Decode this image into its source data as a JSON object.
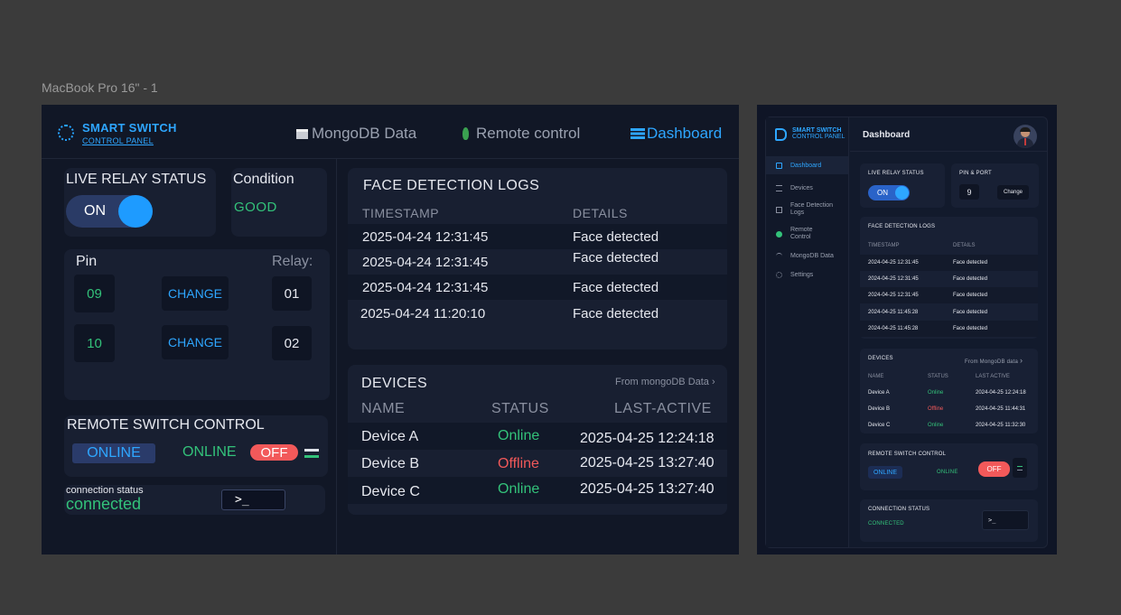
{
  "frame_label": "MacBook Pro 16\" - 1",
  "desktop": {
    "logo": {
      "title": "SMART SWITCH",
      "subtitle": "CONTROL PANEL"
    },
    "nav": [
      {
        "label": "MongoDB Data",
        "icon": "database-icon"
      },
      {
        "label": "Remote control",
        "icon": "mongodb-leaf-icon"
      },
      {
        "label": "Dashboard",
        "icon": "menu-icon",
        "active": true
      }
    ],
    "live_relay": {
      "title": "LIVE RELAY STATUS",
      "toggle_label": "ON"
    },
    "condition": {
      "title": "Condition",
      "value": "GOOD"
    },
    "pins": {
      "pin_label": "Pin",
      "relay_label": "Relay:",
      "rows": [
        {
          "pin": "09",
          "action": "CHANGE",
          "relay": "01"
        },
        {
          "pin": "10",
          "action": "CHANGE",
          "relay": "02"
        }
      ]
    },
    "remote": {
      "title": "REMOTE SWITCH CONTROL",
      "pill": "ONLINE",
      "status": "ONLINE",
      "switch": "OFF"
    },
    "connection": {
      "label": "connection status",
      "value": "connected",
      "terminal": ">_"
    },
    "face_logs": {
      "title": "FACE DETECTION LOGS",
      "headers": [
        "TIMESTAMP",
        "DETAILS"
      ],
      "rows": [
        [
          "2025-04-24 12:31:45",
          "Face detected"
        ],
        [
          "2025-04-24 12:31:45",
          "Face detected"
        ],
        [
          "2025-04-24 12:31:45",
          "Face detected"
        ],
        [
          "2025-04-24 11:20:10",
          "Face detected"
        ]
      ]
    },
    "devices": {
      "title": "DEVICES",
      "link": "From mongoDB Data",
      "headers": [
        "NAME",
        "STATUS",
        "LAST-ACTIVE"
      ],
      "rows": [
        [
          "Device A",
          "Online",
          "2025-04-25 12:24:18"
        ],
        [
          "Device B",
          "Offline",
          "2025-04-25 13:27:40"
        ],
        [
          "Device C",
          "Online",
          "2025-04-25 13:27:40"
        ]
      ]
    }
  },
  "mobile": {
    "logo": {
      "title": "SMART SWITCH",
      "subtitle": "CONTROL PANEL"
    },
    "sidebar": [
      {
        "label": "Dashboard",
        "active": true
      },
      {
        "label": "Devices"
      },
      {
        "label": "Face Detection Logs"
      },
      {
        "label": "Remote Control"
      },
      {
        "label": "MongoDB Data"
      },
      {
        "label": "Settings"
      }
    ],
    "header_title": "Dashboard",
    "live_relay": {
      "title": "LIVE RELAY STATUS",
      "toggle_label": "ON"
    },
    "pin_port": {
      "title": "PIN & PORT",
      "value": "9",
      "action": "Change"
    },
    "face_logs": {
      "title": "FACE DETECTION LOGS",
      "headers": [
        "TIMESTAMP",
        "DETAILS"
      ],
      "rows": [
        [
          "2024-04-25 12:31:45",
          "Face detected"
        ],
        [
          "2024-04-25 12:31:45",
          "Face detected"
        ],
        [
          "2024-04-25 12:31:45",
          "Face detected"
        ],
        [
          "2024-04-25 11:45:28",
          "Face detected"
        ],
        [
          "2024-04-25 11:45:28",
          "Face detected"
        ]
      ]
    },
    "devices": {
      "title": "DEVICES",
      "link": "From MongoDB data",
      "headers": [
        "NAME",
        "STATUS",
        "LAST ACTIVE"
      ],
      "rows": [
        [
          "Device A",
          "Online",
          "2024-04-25 12:24:18"
        ],
        [
          "Device B",
          "Offline",
          "2024-04-25 11:44:31"
        ],
        [
          "Device C",
          "Online",
          "2024-04-25 11:32:30"
        ]
      ]
    },
    "remote": {
      "title": "REMOTE SWITCH CONTROL",
      "pill": "ONLINE",
      "status": "ONLINE",
      "switch": "OFF"
    },
    "connection": {
      "title": "CONNECTION STATUS",
      "value": "CONNECTED",
      "terminal": ">_"
    }
  },
  "colors": {
    "accent": "#2ea6ff",
    "online": "#33c27a",
    "offline": "#f2595a",
    "background": "#111726"
  }
}
